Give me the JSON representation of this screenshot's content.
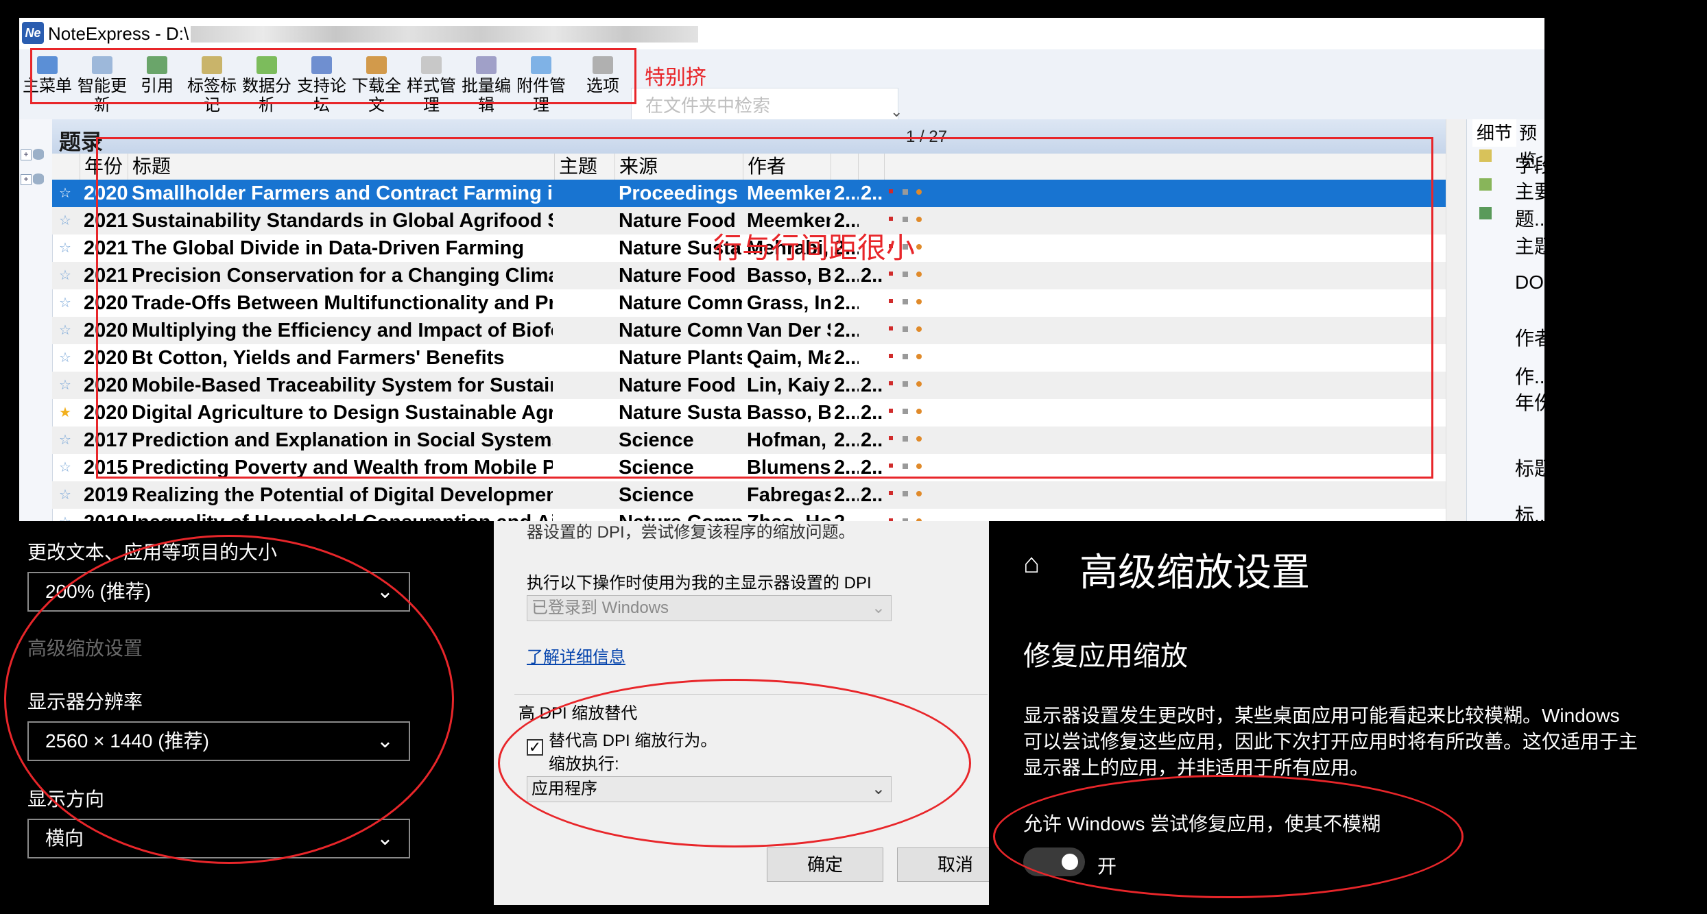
{
  "ne": {
    "app_title": "NoteExpress - D:\\",
    "toolbar": [
      "主菜单",
      "智能更新",
      "引用",
      "标签标记",
      "数据分析",
      "支持论坛",
      "下载全文",
      "样式管理",
      "批量编辑",
      "附件管理",
      "选项"
    ],
    "search_placeholder": "在文件夹中检索",
    "list_title": "题录",
    "page_indicator": "1 / 27",
    "columns": {
      "year": "年份",
      "title": "标题",
      "subject": "主题",
      "source": "来源",
      "author": "作者"
    },
    "rows": [
      {
        "year": "2020",
        "title": "Smallholder Farmers and Contract Farming in Developing Countries",
        "source": "Proceedings of the ...",
        "author": "Meemken, E...",
        "c1": "2...",
        "c2": "2..."
      },
      {
        "year": "2021",
        "title": "Sustainability Standards in Global Agrifood Supply Chains",
        "source": "Nature Food",
        "author": "Meemken, E...",
        "c1": "2...",
        "c2": ""
      },
      {
        "year": "2021",
        "title": "The Global Divide in Data-Driven Farming",
        "source": "Nature Sustainabilit...",
        "author": "Mehrabi, Zia;...",
        "c1": "2...",
        "c2": ""
      },
      {
        "year": "2021",
        "title": "Precision Conservation for a Changing Climate",
        "source": "Nature Food",
        "author": "Basso, Bruno",
        "c1": "2...",
        "c2": "2..."
      },
      {
        "year": "2020",
        "title": "Trade-Offs Between Multifunctionality and Profit in Tropical Smallholde",
        "source": "Nature Communicat...",
        "author": "Grass, Ingo; ...",
        "c1": "2...",
        "c2": ""
      },
      {
        "year": "2020",
        "title": "Multiplying the Efficiency and Impact of Biofortification through Metab",
        "source": "Nature Communicat...",
        "author": "Van Der Stra...",
        "c1": "2...",
        "c2": ""
      },
      {
        "year": "2020",
        "title": "Bt Cotton, Yields and Farmers' Benefits",
        "source": "Nature Plants",
        "author": "Qaim, Matin",
        "c1": "2...",
        "c2": ""
      },
      {
        "year": "2020",
        "title": "Mobile-Based Traceability System for Sustainable Food Supply Networl",
        "source": "Nature Food",
        "author": "Lin, Kaiyuan; ...",
        "c1": "2...",
        "c2": "2..."
      },
      {
        "year": "2020",
        "title": "Digital Agriculture to Design Sustainable Agricultural Systems",
        "source": "Nature Sustainabilit...",
        "author": "Basso, Bruno...",
        "c1": "2...",
        "c2": "2..."
      },
      {
        "year": "2017",
        "title": "Prediction and Explanation in Social Systems",
        "source": "Science",
        "author": "Hofman, Jak...",
        "c1": "2...",
        "c2": "2..."
      },
      {
        "year": "2015",
        "title": "Predicting Poverty and Wealth from Mobile Phone Metadata",
        "source": "Science",
        "author": "Blumenstock...",
        "c1": "2...",
        "c2": "2..."
      },
      {
        "year": "2019",
        "title": "Realizing the Potential of Digital Development: The Case of Agricultura",
        "source": "Science",
        "author": "Fabregas, Rai...",
        "c1": "2...",
        "c2": "2..."
      },
      {
        "year": "2019",
        "title": "Inequality of Household Consumption and Air Pollution-Related Deaths",
        "source": "Nature Communicat...",
        "author": "Zhao, Hongy...",
        "c1": "2...",
        "c2": ""
      }
    ],
    "right_tabs": [
      "细节",
      "预览"
    ],
    "right_fields": [
      "字段",
      "主要字",
      "题...",
      "主题",
      "DOI",
      "作者",
      "作...",
      "年份",
      "标题",
      "标..."
    ]
  },
  "left_panel": {
    "scale_label": "更改文本、应用等项目的大小",
    "scale_value": "200% (推荐)",
    "advanced_link": "高级缩放设置",
    "resolution_label": "显示器分辨率",
    "resolution_value": "2560 × 1440 (推荐)",
    "orientation_label": "显示方向",
    "orientation_value": "横向"
  },
  "dialog": {
    "clipped_text": "器设置的 DPI，尝试修复该程序的缩放问题。",
    "dpi_label": "执行以下操作时使用为我的主显示器设置的 DPI",
    "dpi_value": "已登录到 Windows",
    "learn_more": "了解详细信息",
    "group_title": "高 DPI 缩放替代",
    "override_checkbox": "替代高 DPI 缩放行为。",
    "scaling_by": "缩放执行:",
    "scaling_value": "应用程序",
    "ok": "确定",
    "cancel": "取消"
  },
  "right_panel": {
    "title": "高级缩放设置",
    "section": "修复应用缩放",
    "desc": [
      "显示器设置发生更改时，某些桌面应用可能看起来比较模糊。Windows",
      "可以尝试修复这些应用，因此下次打开应用时将有所改善。这仅适用于主",
      "显示器上的应用，并非适用于所有应用。"
    ],
    "toggle_label": "允许 Windows 尝试修复应用，使其不模糊",
    "toggle_state": "开"
  },
  "annotations": {
    "toolbar_note": "特别挤",
    "rows_note": "行与行间距很小"
  },
  "colors": {
    "selection": "#1874d1",
    "annotation": "#e8262a",
    "header": "#c6d5ea"
  }
}
